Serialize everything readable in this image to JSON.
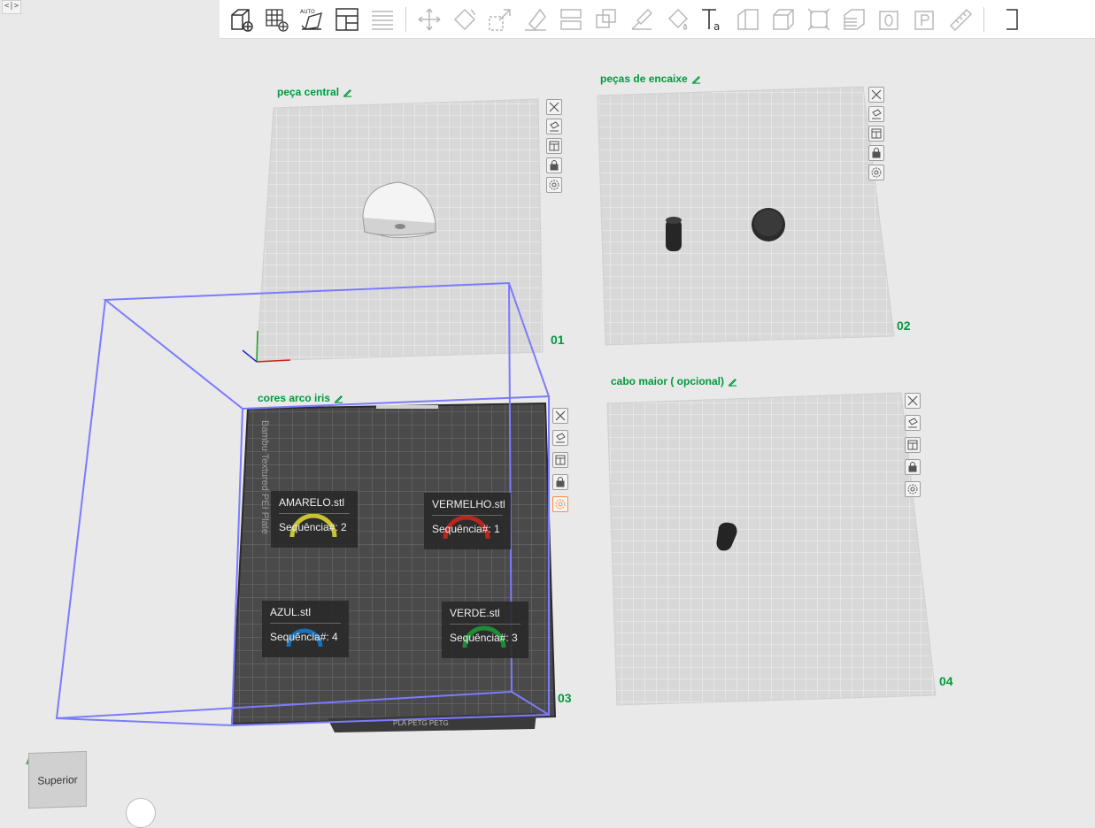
{
  "toolbar": {
    "tools": [
      {
        "name": "add-cube-icon",
        "enabled": true
      },
      {
        "name": "add-plate-icon",
        "enabled": true
      },
      {
        "name": "auto-orient-icon",
        "enabled": true,
        "badge": "AUTO"
      },
      {
        "name": "arrange-icon",
        "enabled": true
      },
      {
        "name": "layers-list-icon",
        "enabled": false
      },
      {
        "name": "move-icon",
        "enabled": false
      },
      {
        "name": "rotate-icon",
        "enabled": false
      },
      {
        "name": "scale-icon",
        "enabled": false
      },
      {
        "name": "lay-on-face-icon",
        "enabled": false
      },
      {
        "name": "cut-icon",
        "enabled": false
      },
      {
        "name": "boolean-icon",
        "enabled": false
      },
      {
        "name": "support-paint-icon",
        "enabled": false
      },
      {
        "name": "color-paint-icon",
        "enabled": false
      },
      {
        "name": "text-icon",
        "enabled": true
      },
      {
        "name": "seam-icon",
        "enabled": false
      },
      {
        "name": "measure-box-icon",
        "enabled": false
      },
      {
        "name": "assembly-icon",
        "enabled": false
      },
      {
        "name": "variable-layer-icon",
        "enabled": false
      },
      {
        "name": "object-icon",
        "enabled": false
      },
      {
        "name": "part-icon",
        "enabled": false
      },
      {
        "name": "ruler-icon",
        "enabled": false
      }
    ]
  },
  "plates": [
    {
      "id": "p1",
      "name": "peça central",
      "number": "01"
    },
    {
      "id": "p2",
      "name": "peças de encaixe",
      "number": "02"
    },
    {
      "id": "p3",
      "name": "cores arco iris",
      "number": "03",
      "brand_text": "Bambu Textured PEI Plate",
      "bottom_text": "PLA PETG PETG"
    },
    {
      "id": "p4",
      "name": "cabo maior ( opcional)",
      "number": "04"
    }
  ],
  "objects": [
    {
      "name": "AMARELO.stl",
      "sequence": "Sequência#: 2",
      "color": "#c9c330"
    },
    {
      "name": "VERMELHO.stl",
      "sequence": "Sequência#: 1",
      "color": "#b8261d"
    },
    {
      "name": "AZUL.stl",
      "sequence": "Sequência#: 4",
      "color": "#1b6fb6"
    },
    {
      "name": "VERDE.stl",
      "sequence": "Sequência#: 3",
      "color": "#1d8d35"
    }
  ],
  "view": {
    "cube_label": "Superior"
  },
  "colors": {
    "accent": "#009a3c",
    "bounding_box": "#7b7bff",
    "active_tool": "#ff8f3c"
  }
}
